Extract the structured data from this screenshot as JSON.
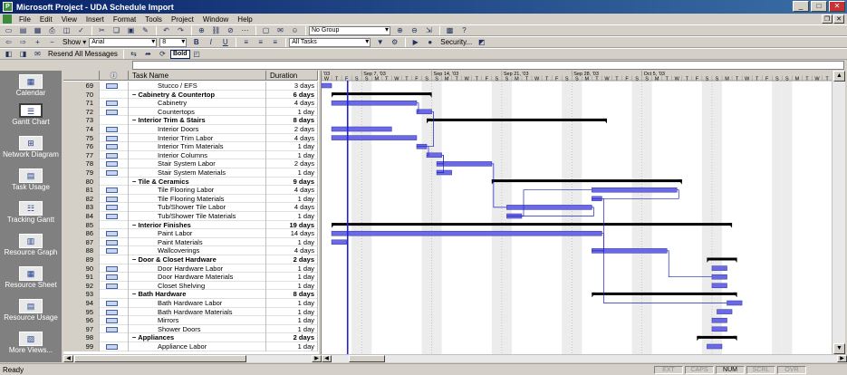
{
  "window": {
    "title": "Microsoft Project - UDA Schedule Import"
  },
  "menu": [
    "File",
    "Edit",
    "View",
    "Insert",
    "Format",
    "Tools",
    "Project",
    "Window",
    "Help"
  ],
  "toolbar1": {
    "group_combo": "No Group"
  },
  "toolbar2": {
    "show_label": "Show ▾",
    "font_combo": "Arial",
    "size_combo": "8",
    "filter_combo": "All Tasks",
    "security_label": "Security..."
  },
  "toolbar3": {
    "resend_label": "Resend All Messages",
    "bold_label": "Bold"
  },
  "table": {
    "headers": {
      "indicators": "ⓘ",
      "name": "Task Name",
      "duration": "Duration"
    },
    "rows": [
      {
        "id": "69",
        "name": "Stucco / EFS",
        "duration": "3 days",
        "note": true,
        "level": 2
      },
      {
        "id": "70",
        "name": "Cabinetry & Countertop",
        "duration": "6 days",
        "note": false,
        "summary": true,
        "level": 1
      },
      {
        "id": "71",
        "name": "Cabinetry",
        "duration": "4 days",
        "note": true,
        "level": 2
      },
      {
        "id": "72",
        "name": "Countertops",
        "duration": "1 day",
        "note": true,
        "level": 2
      },
      {
        "id": "73",
        "name": "Interior Trim & Stairs",
        "duration": "8 days",
        "note": false,
        "summary": true,
        "level": 1
      },
      {
        "id": "74",
        "name": "Interior Doors",
        "duration": "2 days",
        "note": true,
        "level": 2
      },
      {
        "id": "75",
        "name": "Interior Trim Labor",
        "duration": "4 days",
        "note": true,
        "level": 2
      },
      {
        "id": "76",
        "name": "Interior Trim Materials",
        "duration": "1 day",
        "note": true,
        "level": 2
      },
      {
        "id": "77",
        "name": "Interior Columns",
        "duration": "1 day",
        "note": true,
        "level": 2
      },
      {
        "id": "78",
        "name": "Stair System Labor",
        "duration": "2 days",
        "note": true,
        "level": 2
      },
      {
        "id": "79",
        "name": "Stair System Materials",
        "duration": "1 day",
        "note": true,
        "level": 2
      },
      {
        "id": "80",
        "name": "Tile & Ceramics",
        "duration": "9 days",
        "note": false,
        "summary": true,
        "level": 1
      },
      {
        "id": "81",
        "name": "Tile Flooring Labor",
        "duration": "4 days",
        "note": true,
        "level": 2
      },
      {
        "id": "82",
        "name": "Tile Flooring Materials",
        "duration": "1 day",
        "note": true,
        "level": 2
      },
      {
        "id": "83",
        "name": "Tub/Shower Tile Labor",
        "duration": "4 days",
        "note": true,
        "level": 2
      },
      {
        "id": "84",
        "name": "Tub/Shower Tile Materials",
        "duration": "1 day",
        "note": true,
        "level": 2
      },
      {
        "id": "85",
        "name": "Interior Finishes",
        "duration": "19 days",
        "note": false,
        "summary": true,
        "level": 1
      },
      {
        "id": "86",
        "name": "Paint Labor",
        "duration": "14 days",
        "note": true,
        "level": 2
      },
      {
        "id": "87",
        "name": "Paint Materials",
        "duration": "1 day",
        "note": true,
        "level": 2
      },
      {
        "id": "88",
        "name": "Wallcoverings",
        "duration": "4 days",
        "note": true,
        "level": 2
      },
      {
        "id": "89",
        "name": "Door & Closet Hardware",
        "duration": "2 days",
        "note": false,
        "summary": true,
        "level": 1
      },
      {
        "id": "90",
        "name": "Door Hardware Labor",
        "duration": "1 day",
        "note": true,
        "level": 2
      },
      {
        "id": "91",
        "name": "Door Hardware Materials",
        "duration": "1 day",
        "note": true,
        "level": 2
      },
      {
        "id": "92",
        "name": "Closet Shelving",
        "duration": "1 day",
        "note": true,
        "level": 2
      },
      {
        "id": "93",
        "name": "Bath Hardware",
        "duration": "8 days",
        "note": false,
        "summary": true,
        "level": 1
      },
      {
        "id": "94",
        "name": "Bath Hardware Labor",
        "duration": "1 day",
        "note": true,
        "level": 2
      },
      {
        "id": "95",
        "name": "Bath Hardware Materials",
        "duration": "1 day",
        "note": true,
        "level": 2
      },
      {
        "id": "96",
        "name": "Mirrors",
        "duration": "1 day",
        "note": true,
        "level": 2
      },
      {
        "id": "97",
        "name": "Shower Doors",
        "duration": "1 day",
        "note": true,
        "level": 2
      },
      {
        "id": "98",
        "name": "Appliances",
        "duration": "2 days",
        "note": false,
        "summary": true,
        "level": 1
      },
      {
        "id": "99",
        "name": "Appliance Labor",
        "duration": "1 day",
        "note": true,
        "level": 2
      }
    ]
  },
  "gantt": {
    "weeks": [
      "'03",
      "Sep 7, '03",
      "Sep 14, '03",
      "Sep 21, '03",
      "Sep 28, '03",
      "Oct 5, '03"
    ],
    "days": [
      "W",
      "T",
      "F",
      "S",
      "S",
      "M",
      "T",
      "W",
      "T",
      "F",
      "S",
      "S",
      "M",
      "T",
      "W",
      "T",
      "F",
      "S",
      "S",
      "M",
      "T",
      "W",
      "T",
      "F",
      "S",
      "S",
      "M",
      "T",
      "W",
      "T",
      "F",
      "S",
      "S",
      "M",
      "T",
      "W",
      "T",
      "F",
      "S",
      "S",
      "M",
      "T",
      "W",
      "T",
      "F",
      "S",
      "S",
      "M",
      "T",
      "W",
      "T"
    ],
    "bar_color": "#6a6ae6",
    "summary_color": "#000000",
    "today_color": "#2020d0",
    "bars": [
      {
        "row": 0,
        "start": 0,
        "dur": 1
      },
      {
        "row": 1,
        "start": 1,
        "dur": 10,
        "summary": true
      },
      {
        "row": 2,
        "start": 1,
        "dur": 8.5
      },
      {
        "row": 3,
        "start": 9.5,
        "dur": 1.5
      },
      {
        "row": 4,
        "start": 10.5,
        "dur": 18,
        "summary": true
      },
      {
        "row": 5,
        "start": 1,
        "dur": 6
      },
      {
        "row": 6,
        "start": 1,
        "dur": 8.5
      },
      {
        "row": 7,
        "start": 9.5,
        "dur": 1
      },
      {
        "row": 8,
        "start": 10.5,
        "dur": 1.5
      },
      {
        "row": 9,
        "start": 11.5,
        "dur": 5.5
      },
      {
        "row": 10,
        "start": 11.5,
        "dur": 1.5
      },
      {
        "row": 11,
        "start": 17,
        "dur": 19,
        "summary": true
      },
      {
        "row": 12,
        "start": 27,
        "dur": 8.5
      },
      {
        "row": 13,
        "start": 27,
        "dur": 1
      },
      {
        "row": 14,
        "start": 18.5,
        "dur": 8.5
      },
      {
        "row": 15,
        "start": 18.5,
        "dur": 1.5
      },
      {
        "row": 16,
        "start": 1,
        "dur": 40,
        "summary": true
      },
      {
        "row": 17,
        "start": 1,
        "dur": 27
      },
      {
        "row": 18,
        "start": 1,
        "dur": 1.5
      },
      {
        "row": 19,
        "start": 27,
        "dur": 7.5
      },
      {
        "row": 20,
        "start": 38.5,
        "dur": 3,
        "summary": true
      },
      {
        "row": 21,
        "start": 39,
        "dur": 1.5
      },
      {
        "row": 22,
        "start": 39,
        "dur": 1.5
      },
      {
        "row": 23,
        "start": 39,
        "dur": 1.5
      },
      {
        "row": 24,
        "start": 27,
        "dur": 14.5,
        "summary": true
      },
      {
        "row": 25,
        "start": 40.5,
        "dur": 1.5
      },
      {
        "row": 26,
        "start": 39.5,
        "dur": 1.5
      },
      {
        "row": 27,
        "start": 39,
        "dur": 1.5
      },
      {
        "row": 28,
        "start": 39,
        "dur": 1.5
      },
      {
        "row": 29,
        "start": 37.5,
        "dur": 4,
        "summary": true
      },
      {
        "row": 30,
        "start": 38.5,
        "dur": 1.5
      }
    ]
  },
  "viewbar": [
    "Calendar",
    "Gantt Chart",
    "Network Diagram",
    "Task Usage",
    "Tracking Gantt",
    "Resource Graph",
    "Resource Sheet",
    "Resource Usage",
    "More Views..."
  ],
  "status": {
    "text": "Ready",
    "indicators": [
      "EXT",
      "CAPS",
      "NUM",
      "SCRL",
      "OVR"
    ],
    "active": "NUM"
  }
}
